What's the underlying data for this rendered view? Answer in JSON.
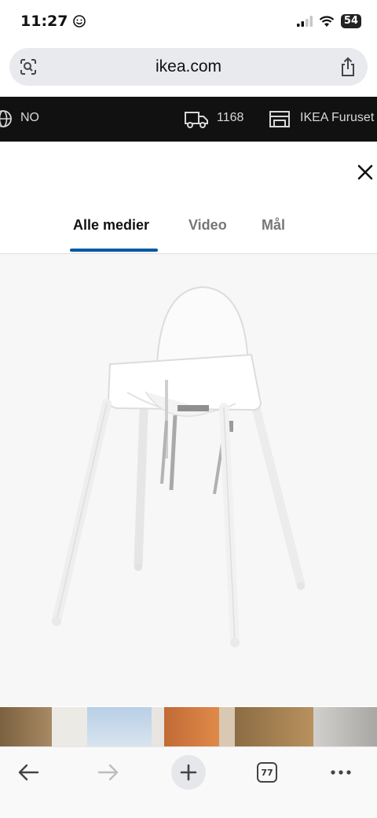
{
  "status": {
    "time": "11:27",
    "battery": "54"
  },
  "browser": {
    "url": "ikea.com",
    "tab_count": "77"
  },
  "ikea_bar": {
    "language": "NO",
    "postcode": "1168",
    "store": "IKEA Furuset"
  },
  "tabs": [
    {
      "label": "Alle medier",
      "active": true
    },
    {
      "label": "Video",
      "active": false
    },
    {
      "label": "Mål",
      "active": false
    }
  ],
  "colors": {
    "accent": "#0058a3",
    "top_bar": "#111111",
    "url_bar": "#e8eaed"
  },
  "icons": [
    "smiley-icon",
    "signal-icon",
    "wifi-icon",
    "battery-icon",
    "page-scan-icon",
    "share-icon",
    "globe-icon",
    "truck-icon",
    "store-icon",
    "close-icon",
    "back-arrow-icon",
    "forward-arrow-icon",
    "plus-icon",
    "tabs-icon",
    "more-icon"
  ]
}
